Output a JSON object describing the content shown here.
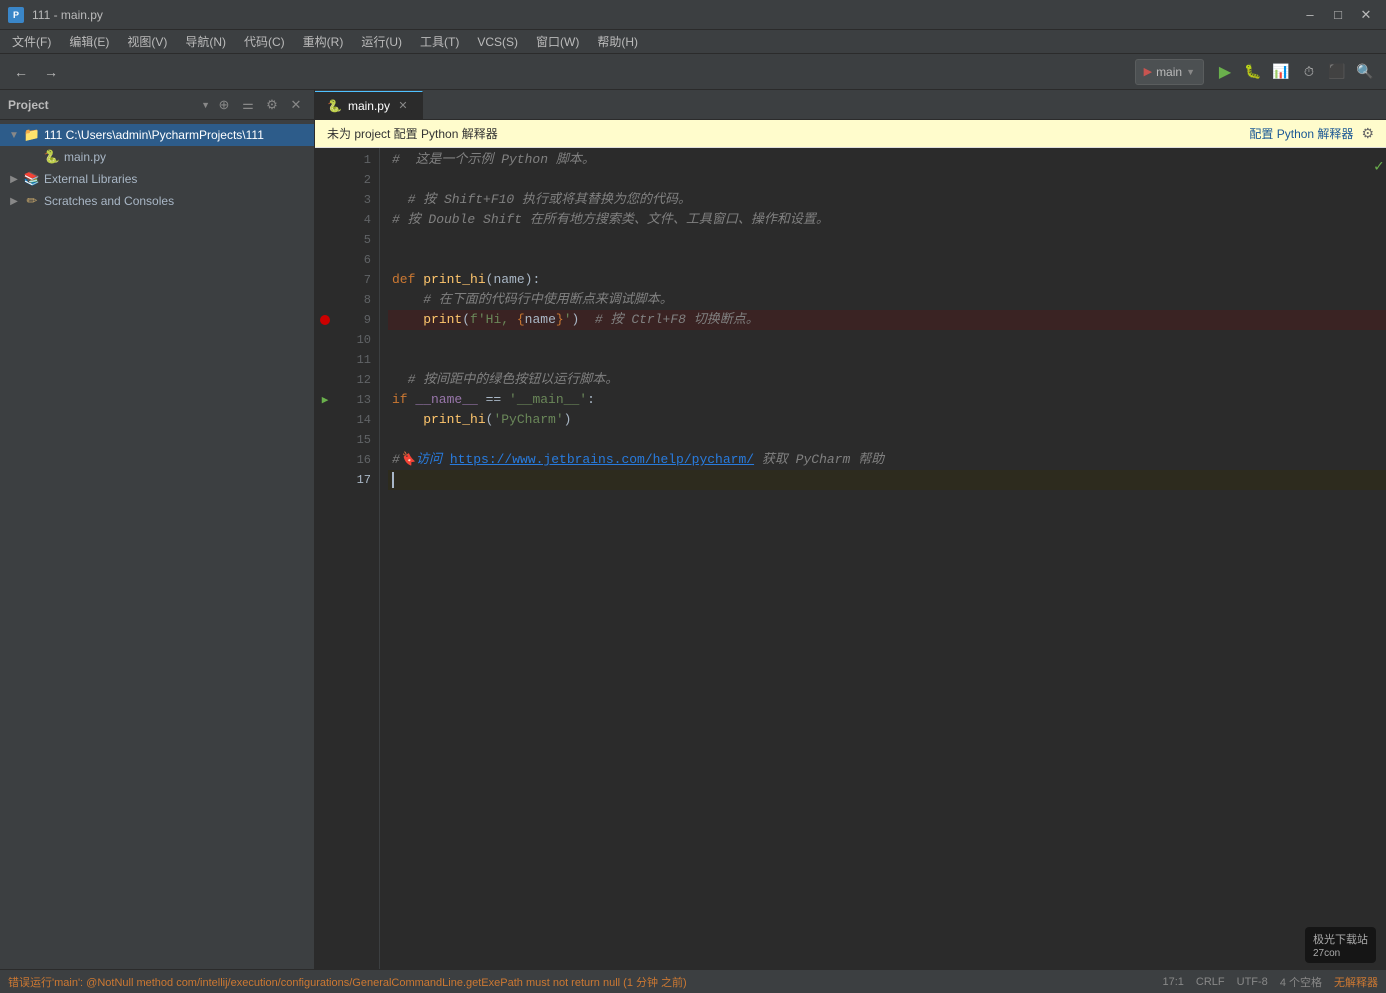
{
  "window": {
    "title": "111 - main.py",
    "project_num": "111",
    "file_name": "main.py"
  },
  "menu": {
    "items": [
      "文件(F)",
      "编辑(E)",
      "视图(V)",
      "导航(N)",
      "代码(C)",
      "重构(R)",
      "运行(U)",
      "工具(T)",
      "VCS(S)",
      "窗口(W)",
      "帮助(H)"
    ]
  },
  "toolbar": {
    "run_config_label": "main",
    "run_config_icon": "▶"
  },
  "sidebar": {
    "title": "Project",
    "tree": [
      {
        "label": "111  C:\\Users\\admin\\PycharmProjects\\111",
        "level": 0,
        "expanded": true,
        "icon": "📁",
        "is_project": true
      },
      {
        "label": "main.py",
        "level": 1,
        "expanded": false,
        "icon": "🐍"
      },
      {
        "label": "External Libraries",
        "level": 0,
        "expanded": false,
        "icon": "📚"
      },
      {
        "label": "Scratches and Consoles",
        "level": 0,
        "expanded": false,
        "icon": "📝"
      }
    ]
  },
  "editor": {
    "tab_name": "main.py",
    "warning_text": "未为 project 配置 Python 解释器",
    "config_link_text": "配置 Python 解释器",
    "lines": [
      {
        "num": 1,
        "content": "#  这是一个示例 Python 脚本。",
        "type": "comment"
      },
      {
        "num": 2,
        "content": "",
        "type": "empty"
      },
      {
        "num": 3,
        "content": "  # 按 Shift+F10 执行或将其替换为您的代码。",
        "type": "comment"
      },
      {
        "num": 4,
        "content": "# 按 Double Shift 在所有地方搜索类、文件、工具窗口、操作和设置。",
        "type": "comment"
      },
      {
        "num": 5,
        "content": "",
        "type": "empty"
      },
      {
        "num": 6,
        "content": "",
        "type": "empty"
      },
      {
        "num": 7,
        "content": "def print_hi(name):",
        "type": "code_def"
      },
      {
        "num": 8,
        "content": "    # 在下面的代码行中使用断点来调试脚本。",
        "type": "comment_indent"
      },
      {
        "num": 9,
        "content": "    print(f'Hi, {name}')  # 按 Ctrl+F8 切换断点。",
        "type": "breakpoint"
      },
      {
        "num": 10,
        "content": "",
        "type": "empty"
      },
      {
        "num": 11,
        "content": "",
        "type": "empty"
      },
      {
        "num": 12,
        "content": "  # 按间距中的绿色按钮以运行脚本。",
        "type": "comment"
      },
      {
        "num": 13,
        "content": "if __name__ == '__main__':",
        "type": "code_if"
      },
      {
        "num": 14,
        "content": "    print_hi('PyCharm')",
        "type": "code_call"
      },
      {
        "num": 15,
        "content": "",
        "type": "empty"
      },
      {
        "num": 16,
        "content": "#  访问 https://www.jetbrains.com/help/pycharm/ 获取 PyCharm 帮助",
        "type": "comment_link"
      },
      {
        "num": 17,
        "content": "",
        "type": "current"
      }
    ]
  },
  "status_bar": {
    "error_text": "错误运行'main': @NotNull method com/intellij/execution/configurations/GeneralCommandLine.getExePath must not return null (1 分钟 之前)",
    "position": "17:1",
    "encoding": "CRLF",
    "charset": "UTF-8",
    "spaces": "4 个空格",
    "interpreter": "无解释器"
  },
  "watermark": {
    "text": "极光下载站",
    "sub": "27con"
  }
}
